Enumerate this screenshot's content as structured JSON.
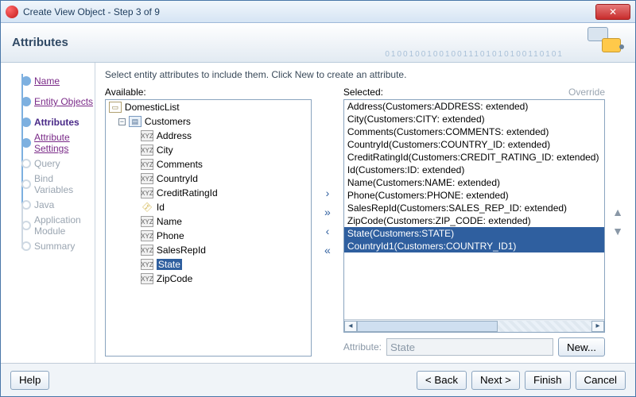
{
  "window": {
    "title": "Create View Object - Step 3 of 9"
  },
  "banner": {
    "heading": "Attributes",
    "digits": "010010010010011101010100110101"
  },
  "wizard_steps": [
    {
      "label": "Name",
      "state": "done",
      "interact": true
    },
    {
      "label": "Entity Objects",
      "state": "done",
      "interact": true
    },
    {
      "label": "Attributes",
      "state": "active",
      "interact": true
    },
    {
      "label": "Attribute Settings",
      "state": "done",
      "interact": true
    },
    {
      "label": "Query",
      "state": "pending",
      "interact": false
    },
    {
      "label": "Bind Variables",
      "state": "pending",
      "interact": false
    },
    {
      "label": "Java",
      "state": "pending",
      "interact": false
    },
    {
      "label": "Application Module",
      "state": "pending",
      "interact": false
    },
    {
      "label": "Summary",
      "state": "pending",
      "interact": false
    }
  ],
  "hint_text": "Select entity attributes to include them.  Click New to create an attribute.",
  "left": {
    "label": "Available:",
    "root": {
      "name": "DomesticList",
      "icon": "pkg"
    },
    "entity": {
      "name": "Customers",
      "icon": "ent",
      "expanded": true
    },
    "attributes": [
      {
        "name": "Address",
        "icon": "attr"
      },
      {
        "name": "City",
        "icon": "attr"
      },
      {
        "name": "Comments",
        "icon": "attr"
      },
      {
        "name": "CountryId",
        "icon": "attr"
      },
      {
        "name": "CreditRatingId",
        "icon": "attr"
      },
      {
        "name": "Id",
        "icon": "key"
      },
      {
        "name": "Name",
        "icon": "attr"
      },
      {
        "name": "Phone",
        "icon": "attr"
      },
      {
        "name": "SalesRepId",
        "icon": "attr"
      },
      {
        "name": "State",
        "icon": "attr",
        "selected": true
      },
      {
        "name": "ZipCode",
        "icon": "attr"
      }
    ]
  },
  "right": {
    "label": "Selected:",
    "override": "Override",
    "items": [
      {
        "text": "Address(Customers:ADDRESS: extended)",
        "hl": false
      },
      {
        "text": "City(Customers:CITY: extended)",
        "hl": false
      },
      {
        "text": "Comments(Customers:COMMENTS: extended)",
        "hl": false
      },
      {
        "text": "CountryId(Customers:COUNTRY_ID: extended)",
        "hl": false
      },
      {
        "text": "CreditRatingId(Customers:CREDIT_RATING_ID: extended)",
        "hl": false
      },
      {
        "text": "Id(Customers:ID: extended)",
        "hl": false
      },
      {
        "text": "Name(Customers:NAME: extended)",
        "hl": false
      },
      {
        "text": "Phone(Customers:PHONE: extended)",
        "hl": false
      },
      {
        "text": "SalesRepId(Customers:SALES_REP_ID: extended)",
        "hl": false
      },
      {
        "text": "ZipCode(Customers:ZIP_CODE: extended)",
        "hl": false
      },
      {
        "text": "State(Customers:STATE)",
        "hl": true
      },
      {
        "text": "CountryId1(Customers:COUNTRY_ID1)",
        "hl": true
      }
    ]
  },
  "shuttle": {
    "add": "›",
    "add_all": "»",
    "remove": "‹",
    "remove_all": "«"
  },
  "reorder": {
    "up": "▲",
    "down": "▼"
  },
  "attribute_field": {
    "label": "Attribute:",
    "value": "State"
  },
  "buttons": {
    "new": "New...",
    "help": "Help",
    "back": "< Back",
    "next": "Next >",
    "finish": "Finish",
    "cancel": "Cancel"
  },
  "icon_text": {
    "attr": "XYZ",
    "key": "⚿",
    "pkg": "▭",
    "ent": "▤",
    "exp_minus": "−"
  }
}
